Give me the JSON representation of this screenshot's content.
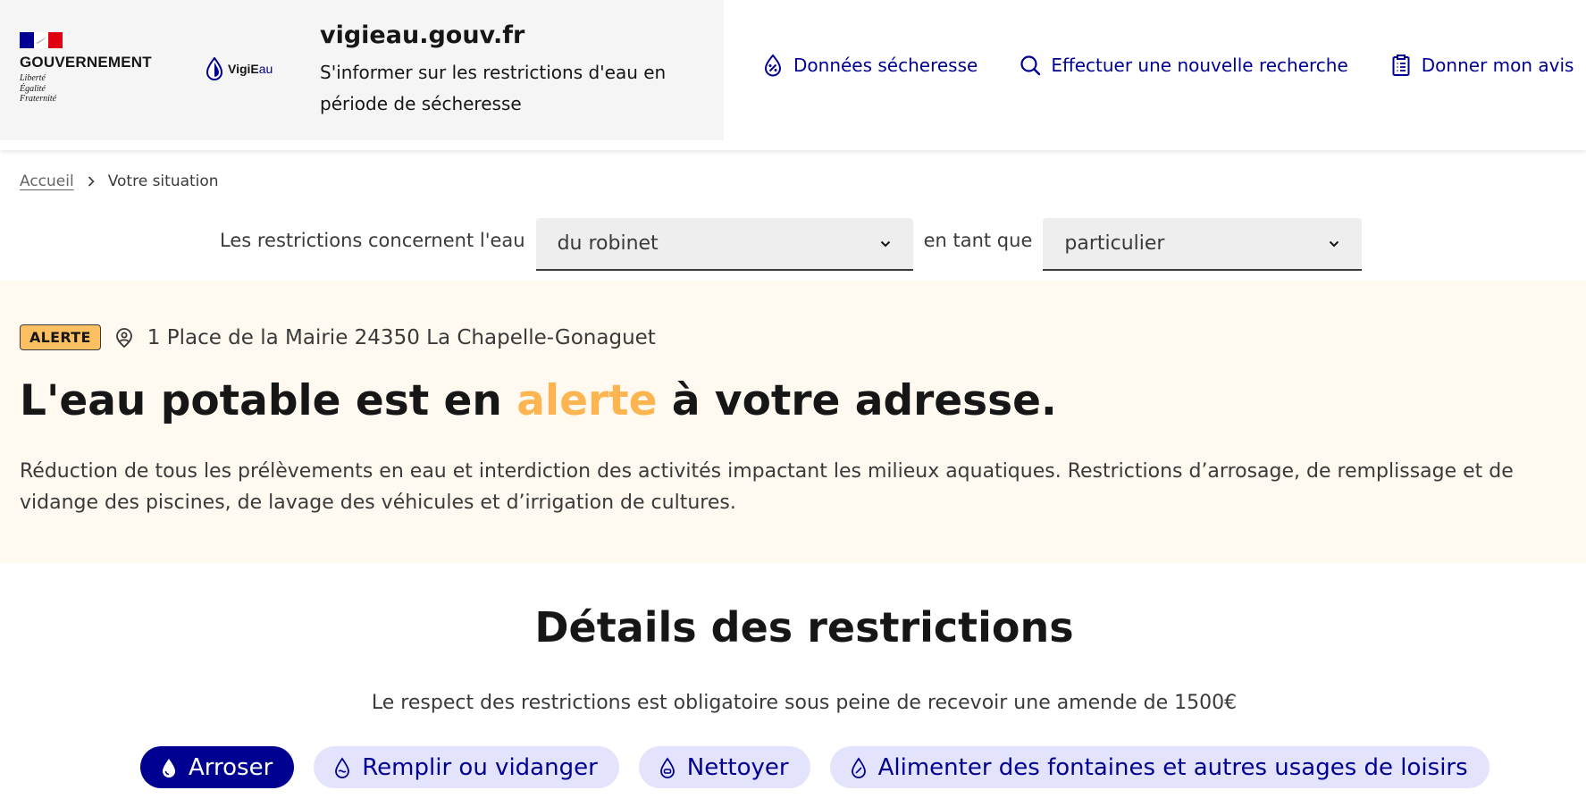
{
  "header": {
    "gov_name": "GOUVERNEMENT",
    "motto": [
      "Liberté",
      "Égalité",
      "Fraternité"
    ],
    "flag_colors": [
      "#000091",
      "#ffffff",
      "#e1000f"
    ],
    "logo_text_bold": "VigiE",
    "logo_text_light": "au",
    "site_title": "vigieau.gouv.fr",
    "tagline": "S'informer sur les restrictions d'eau en période de sécheresse",
    "nav": [
      {
        "label": "Données sécheresse",
        "icon": "drop-percent-icon"
      },
      {
        "label": "Effectuer une nouvelle recherche",
        "icon": "search-icon"
      },
      {
        "label": "Donner mon avis",
        "icon": "clipboard-icon"
      }
    ]
  },
  "breadcrumb": {
    "home": "Accueil",
    "current": "Votre situation"
  },
  "filters": {
    "label_1": "Les restrictions concernent l'eau",
    "select_1_value": "du robinet",
    "label_2": "en tant que",
    "select_2_value": "particulier"
  },
  "alert": {
    "badge": "ALERTE",
    "address": "1 Place de la Mairie 24350 La Chapelle-Gonaguet",
    "title_before": "L'eau potable est en ",
    "title_accent": "alerte",
    "title_after": " à votre adresse.",
    "description": "Réduction de tous les prélèvements en eau et interdiction des activités impactant les milieux aquatiques. Restrictions d’arrosage, de remplissage et de vidange des piscines, de lavage des véhicules et d’irrigation de cultures.",
    "accent_color": "#fcb551",
    "badge_color": "#fcc063"
  },
  "details": {
    "title": "Détails des restrictions",
    "note": "Le respect des restrictions est obligatoire sous peine de recevoir une amende de 1500€",
    "tabs": [
      {
        "label": "Arroser",
        "icon": "watering-drop-icon",
        "active": true
      },
      {
        "label": "Remplir ou vidanger",
        "icon": "pool-drop-icon",
        "active": false
      },
      {
        "label": "Nettoyer",
        "icon": "cleaning-drop-icon",
        "active": false
      },
      {
        "label": "Alimenter des fontaines et autres usages de loisirs",
        "icon": "fountain-drop-icon",
        "active": false
      }
    ]
  }
}
